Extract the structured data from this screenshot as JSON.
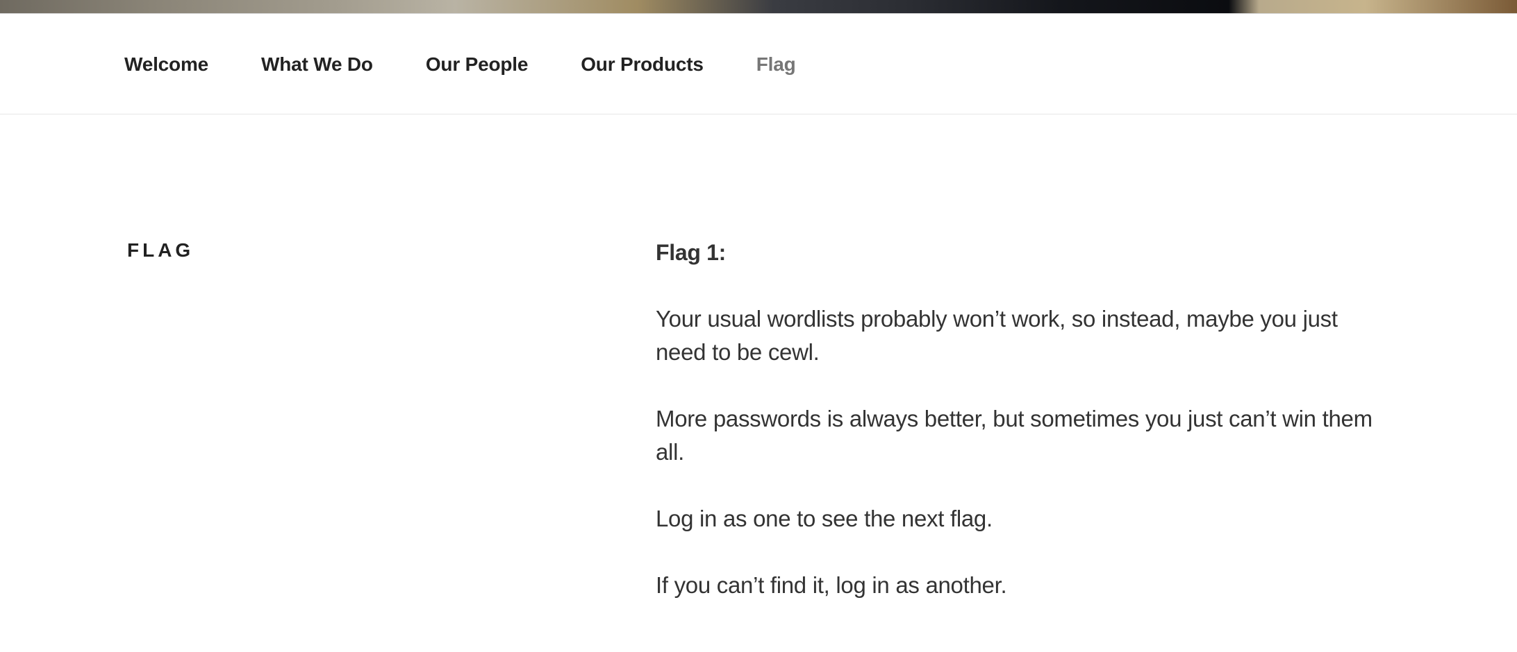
{
  "nav": {
    "items": [
      {
        "label": "Welcome"
      },
      {
        "label": "What We Do"
      },
      {
        "label": "Our People"
      },
      {
        "label": "Our Products"
      },
      {
        "label": "Flag",
        "current": true
      }
    ]
  },
  "page": {
    "title": "FLAG"
  },
  "entry": {
    "heading": "Flag 1:",
    "paragraphs": [
      "Your usual wordlists probably won’t work, so instead, maybe you just need to be cewl.",
      "More passwords is always better, but sometimes you just can’t win them all.",
      "Log in as one to see the next flag.",
      "If you can’t find it, log in as another."
    ]
  },
  "colors": {
    "text": "#222222",
    "body_text": "#333333",
    "current_nav": "#767676",
    "divider": "#e6e6e6"
  }
}
